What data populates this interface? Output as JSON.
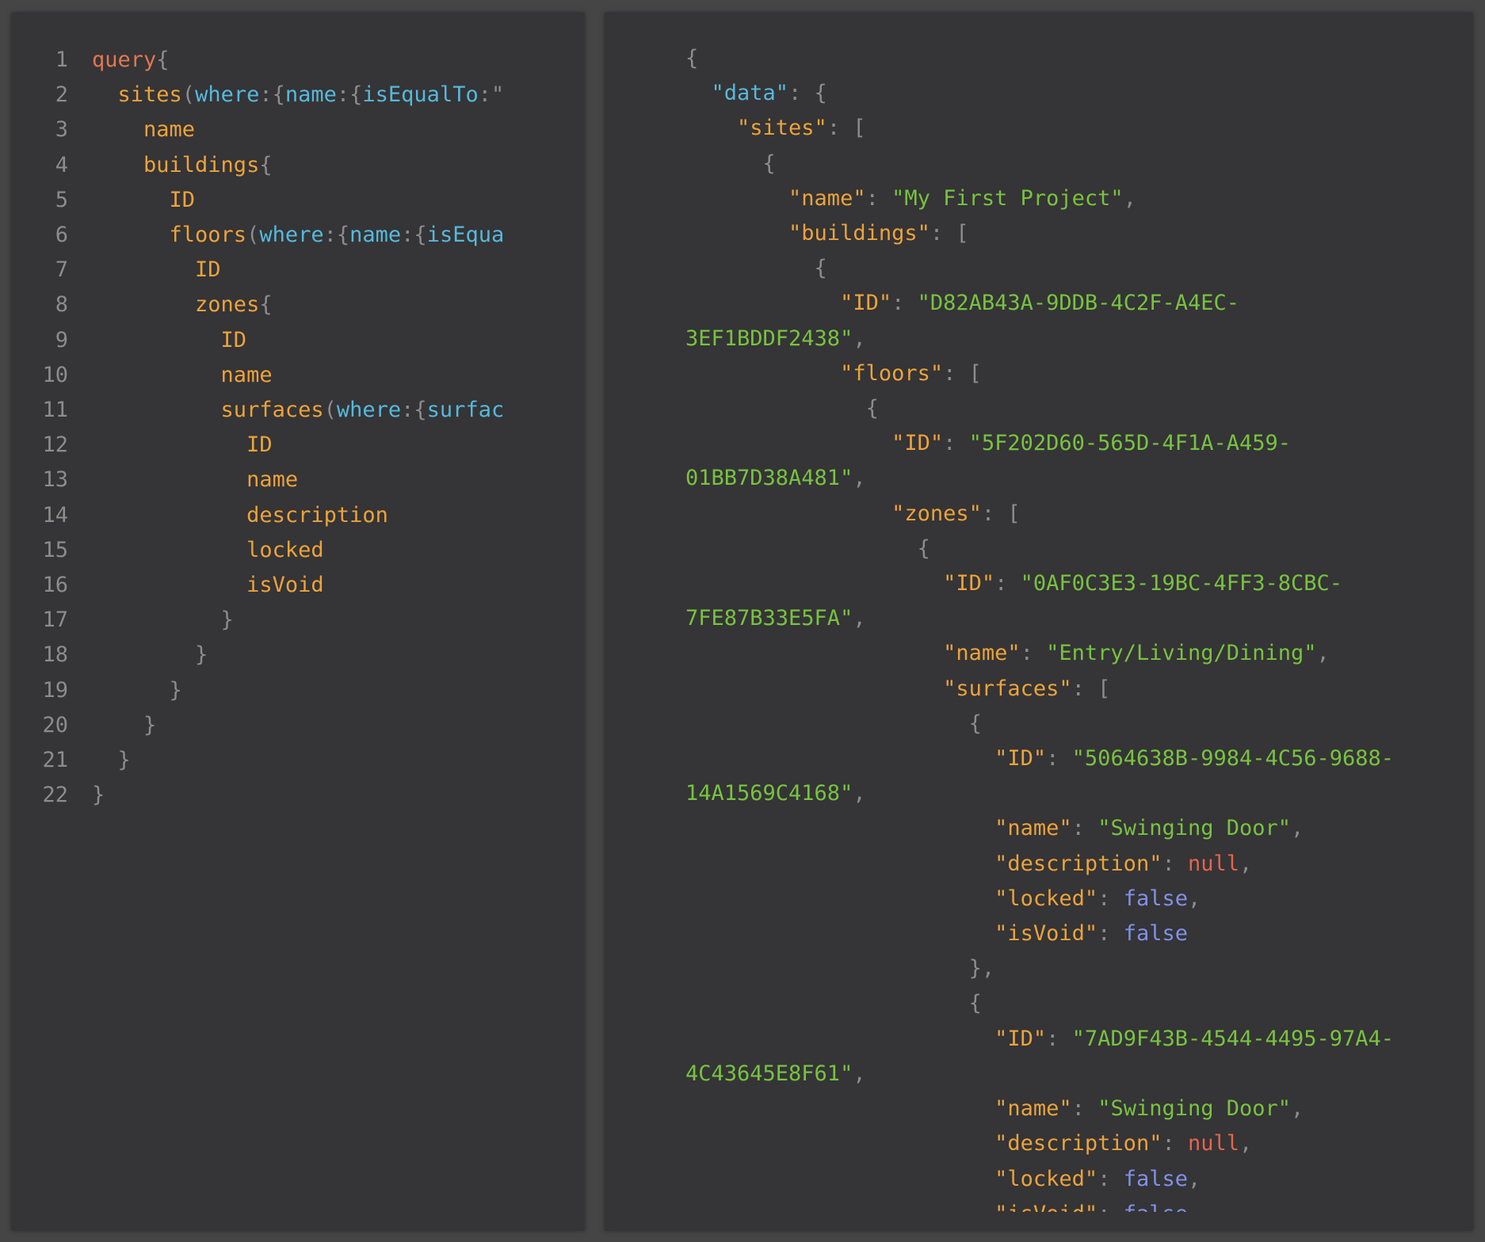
{
  "editor": {
    "title": "",
    "query_lines": [
      [
        {
          "t": "query",
          "c": "op"
        },
        {
          "t": "{",
          "c": "punc"
        }
      ],
      [
        {
          "t": "  sites",
          "c": "field"
        },
        {
          "t": "(",
          "c": "punc"
        },
        {
          "t": "where",
          "c": "arg"
        },
        {
          "t": ":{",
          "c": "punc"
        },
        {
          "t": "name",
          "c": "arg"
        },
        {
          "t": ":{",
          "c": "punc"
        },
        {
          "t": "isEqualTo",
          "c": "arg"
        },
        {
          "t": ":\"",
          "c": "punc"
        }
      ],
      [
        {
          "t": "    name",
          "c": "field"
        }
      ],
      [
        {
          "t": "    buildings",
          "c": "field"
        },
        {
          "t": "{",
          "c": "punc"
        }
      ],
      [
        {
          "t": "      ID",
          "c": "field"
        }
      ],
      [
        {
          "t": "      floors",
          "c": "field"
        },
        {
          "t": "(",
          "c": "punc"
        },
        {
          "t": "where",
          "c": "arg"
        },
        {
          "t": ":{",
          "c": "punc"
        },
        {
          "t": "name",
          "c": "arg"
        },
        {
          "t": ":{",
          "c": "punc"
        },
        {
          "t": "isEqua",
          "c": "arg"
        }
      ],
      [
        {
          "t": "        ID",
          "c": "field"
        }
      ],
      [
        {
          "t": "        zones",
          "c": "field"
        },
        {
          "t": "{",
          "c": "punc"
        }
      ],
      [
        {
          "t": "          ID",
          "c": "field"
        }
      ],
      [
        {
          "t": "          name",
          "c": "field"
        }
      ],
      [
        {
          "t": "          surfaces",
          "c": "field"
        },
        {
          "t": "(",
          "c": "punc"
        },
        {
          "t": "where",
          "c": "arg"
        },
        {
          "t": ":{",
          "c": "punc"
        },
        {
          "t": "surfac",
          "c": "arg"
        }
      ],
      [
        {
          "t": "            ID",
          "c": "field"
        }
      ],
      [
        {
          "t": "            name",
          "c": "field"
        }
      ],
      [
        {
          "t": "            description",
          "c": "field"
        }
      ],
      [
        {
          "t": "            locked",
          "c": "field"
        }
      ],
      [
        {
          "t": "            isVoid",
          "c": "field"
        }
      ],
      [
        {
          "t": "          }",
          "c": "punc"
        }
      ],
      [
        {
          "t": "        }",
          "c": "punc"
        }
      ],
      [
        {
          "t": "      }",
          "c": "punc"
        }
      ],
      [
        {
          "t": "    }",
          "c": "punc"
        }
      ],
      [
        {
          "t": "  }",
          "c": "punc"
        }
      ],
      [
        {
          "t": "}",
          "c": "punc"
        }
      ]
    ]
  },
  "result": {
    "lines": [
      [
        {
          "t": "{",
          "c": "punc"
        }
      ],
      [
        {
          "t": "  \"data\"",
          "c": "arg"
        },
        {
          "t": ": {",
          "c": "punc"
        }
      ],
      [
        {
          "t": "    \"sites\"",
          "c": "field"
        },
        {
          "t": ": [",
          "c": "punc"
        }
      ],
      [
        {
          "t": "      {",
          "c": "punc"
        }
      ],
      [
        {
          "t": "        \"name\"",
          "c": "field"
        },
        {
          "t": ": ",
          "c": "punc"
        },
        {
          "t": "\"My First Project\"",
          "c": "str"
        },
        {
          "t": ",",
          "c": "punc"
        }
      ],
      [
        {
          "t": "        \"buildings\"",
          "c": "field"
        },
        {
          "t": ": [",
          "c": "punc"
        }
      ],
      [
        {
          "t": "          {",
          "c": "punc"
        }
      ],
      [
        {
          "t": "            \"ID\"",
          "c": "field"
        },
        {
          "t": ": ",
          "c": "punc"
        },
        {
          "t": "\"D82AB43A-9DDB-4C2F-A4EC-",
          "c": "str"
        }
      ],
      [
        {
          "t": "3EF1BDDF2438\"",
          "c": "str"
        },
        {
          "t": ",",
          "c": "punc"
        }
      ],
      [
        {
          "t": "            \"floors\"",
          "c": "field"
        },
        {
          "t": ": [",
          "c": "punc"
        }
      ],
      [
        {
          "t": "              {",
          "c": "punc"
        }
      ],
      [
        {
          "t": "                \"ID\"",
          "c": "field"
        },
        {
          "t": ": ",
          "c": "punc"
        },
        {
          "t": "\"5F202D60-565D-4F1A-A459-",
          "c": "str"
        }
      ],
      [
        {
          "t": "01BB7D38A481\"",
          "c": "str"
        },
        {
          "t": ",",
          "c": "punc"
        }
      ],
      [
        {
          "t": "                \"zones\"",
          "c": "field"
        },
        {
          "t": ": [",
          "c": "punc"
        }
      ],
      [
        {
          "t": "                  {",
          "c": "punc"
        }
      ],
      [
        {
          "t": "                    \"ID\"",
          "c": "field"
        },
        {
          "t": ": ",
          "c": "punc"
        },
        {
          "t": "\"0AF0C3E3-19BC-4FF3-8CBC-",
          "c": "str"
        }
      ],
      [
        {
          "t": "7FE87B33E5FA\"",
          "c": "str"
        },
        {
          "t": ",",
          "c": "punc"
        }
      ],
      [
        {
          "t": "                    \"name\"",
          "c": "field"
        },
        {
          "t": ": ",
          "c": "punc"
        },
        {
          "t": "\"Entry/Living/Dining\"",
          "c": "str"
        },
        {
          "t": ",",
          "c": "punc"
        }
      ],
      [
        {
          "t": "                    \"surfaces\"",
          "c": "field"
        },
        {
          "t": ": [",
          "c": "punc"
        }
      ],
      [
        {
          "t": "                      {",
          "c": "punc"
        }
      ],
      [
        {
          "t": "                        \"ID\"",
          "c": "field"
        },
        {
          "t": ": ",
          "c": "punc"
        },
        {
          "t": "\"5064638B-9984-4C56-9688-",
          "c": "str"
        }
      ],
      [
        {
          "t": "14A1569C4168\"",
          "c": "str"
        },
        {
          "t": ",",
          "c": "punc"
        }
      ],
      [
        {
          "t": "                        \"name\"",
          "c": "field"
        },
        {
          "t": ": ",
          "c": "punc"
        },
        {
          "t": "\"Swinging Door\"",
          "c": "str"
        },
        {
          "t": ",",
          "c": "punc"
        }
      ],
      [
        {
          "t": "                        \"description\"",
          "c": "field"
        },
        {
          "t": ": ",
          "c": "punc"
        },
        {
          "t": "null",
          "c": "null"
        },
        {
          "t": ",",
          "c": "punc"
        }
      ],
      [
        {
          "t": "                        \"locked\"",
          "c": "field"
        },
        {
          "t": ": ",
          "c": "punc"
        },
        {
          "t": "false",
          "c": "bool"
        },
        {
          "t": ",",
          "c": "punc"
        }
      ],
      [
        {
          "t": "                        \"isVoid\"",
          "c": "field"
        },
        {
          "t": ": ",
          "c": "punc"
        },
        {
          "t": "false",
          "c": "bool"
        }
      ],
      [
        {
          "t": "                      },",
          "c": "punc"
        }
      ],
      [
        {
          "t": "                      {",
          "c": "punc"
        }
      ],
      [
        {
          "t": "                        \"ID\"",
          "c": "field"
        },
        {
          "t": ": ",
          "c": "punc"
        },
        {
          "t": "\"7AD9F43B-4544-4495-97A4-",
          "c": "str"
        }
      ],
      [
        {
          "t": "4C43645E8F61\"",
          "c": "str"
        },
        {
          "t": ",",
          "c": "punc"
        }
      ],
      [
        {
          "t": "                        \"name\"",
          "c": "field"
        },
        {
          "t": ": ",
          "c": "punc"
        },
        {
          "t": "\"Swinging Door\"",
          "c": "str"
        },
        {
          "t": ",",
          "c": "punc"
        }
      ],
      [
        {
          "t": "                        \"description\"",
          "c": "field"
        },
        {
          "t": ": ",
          "c": "punc"
        },
        {
          "t": "null",
          "c": "null"
        },
        {
          "t": ",",
          "c": "punc"
        }
      ],
      [
        {
          "t": "                        \"locked\"",
          "c": "field"
        },
        {
          "t": ": ",
          "c": "punc"
        },
        {
          "t": "false",
          "c": "bool"
        },
        {
          "t": ",",
          "c": "punc"
        }
      ],
      [
        {
          "t": "                        \"isVoid\"",
          "c": "field"
        },
        {
          "t": ": ",
          "c": "punc"
        },
        {
          "t": "false",
          "c": "bool"
        }
      ]
    ]
  },
  "colors": {
    "background": "#454545",
    "pane": "#353436",
    "keyword": "#e07850",
    "field": "#eba33b",
    "argument": "#55b9dc",
    "punctuation": "#8c8c8c",
    "string": "#77c340",
    "null": "#e2654e",
    "boolean": "#7f91e8"
  }
}
